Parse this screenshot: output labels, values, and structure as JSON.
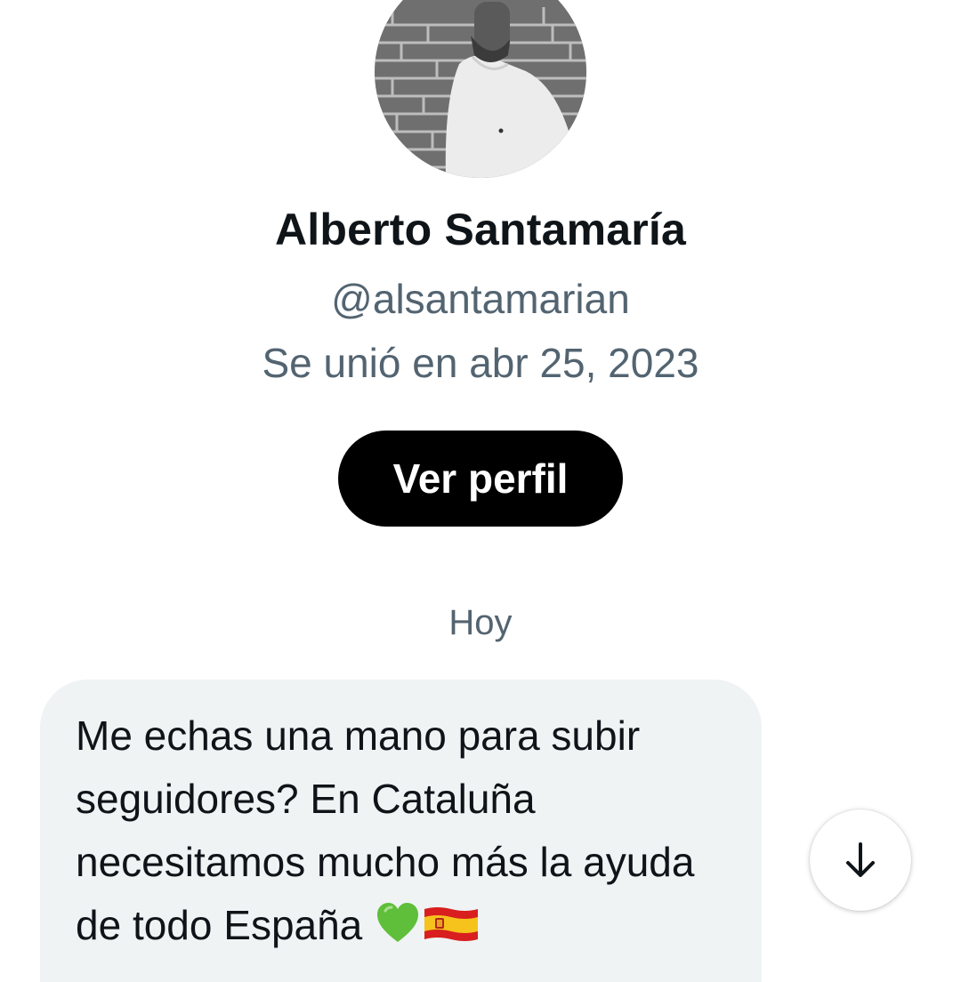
{
  "profile": {
    "display_name": "Alberto Santamaría",
    "handle": "@alsantamarian",
    "joined": "Se unió en abr 25, 2023",
    "view_profile_label": "Ver perfil"
  },
  "conversation": {
    "day_separator": "Hoy",
    "messages": [
      {
        "text": "Me echas una mano para subir seguidores? En Cataluña necesitamos mucho más la ayuda de todo España",
        "emojis": [
          "green-heart-icon",
          "spain-flag-icon"
        ]
      }
    ]
  },
  "controls": {
    "scroll_down_icon": "arrow-down-icon"
  },
  "colors": {
    "text_primary": "#0f1419",
    "text_secondary": "#536471",
    "button_bg": "#000000",
    "bubble_bg": "#eff3f4",
    "heart_green": "#5fbf3b"
  }
}
